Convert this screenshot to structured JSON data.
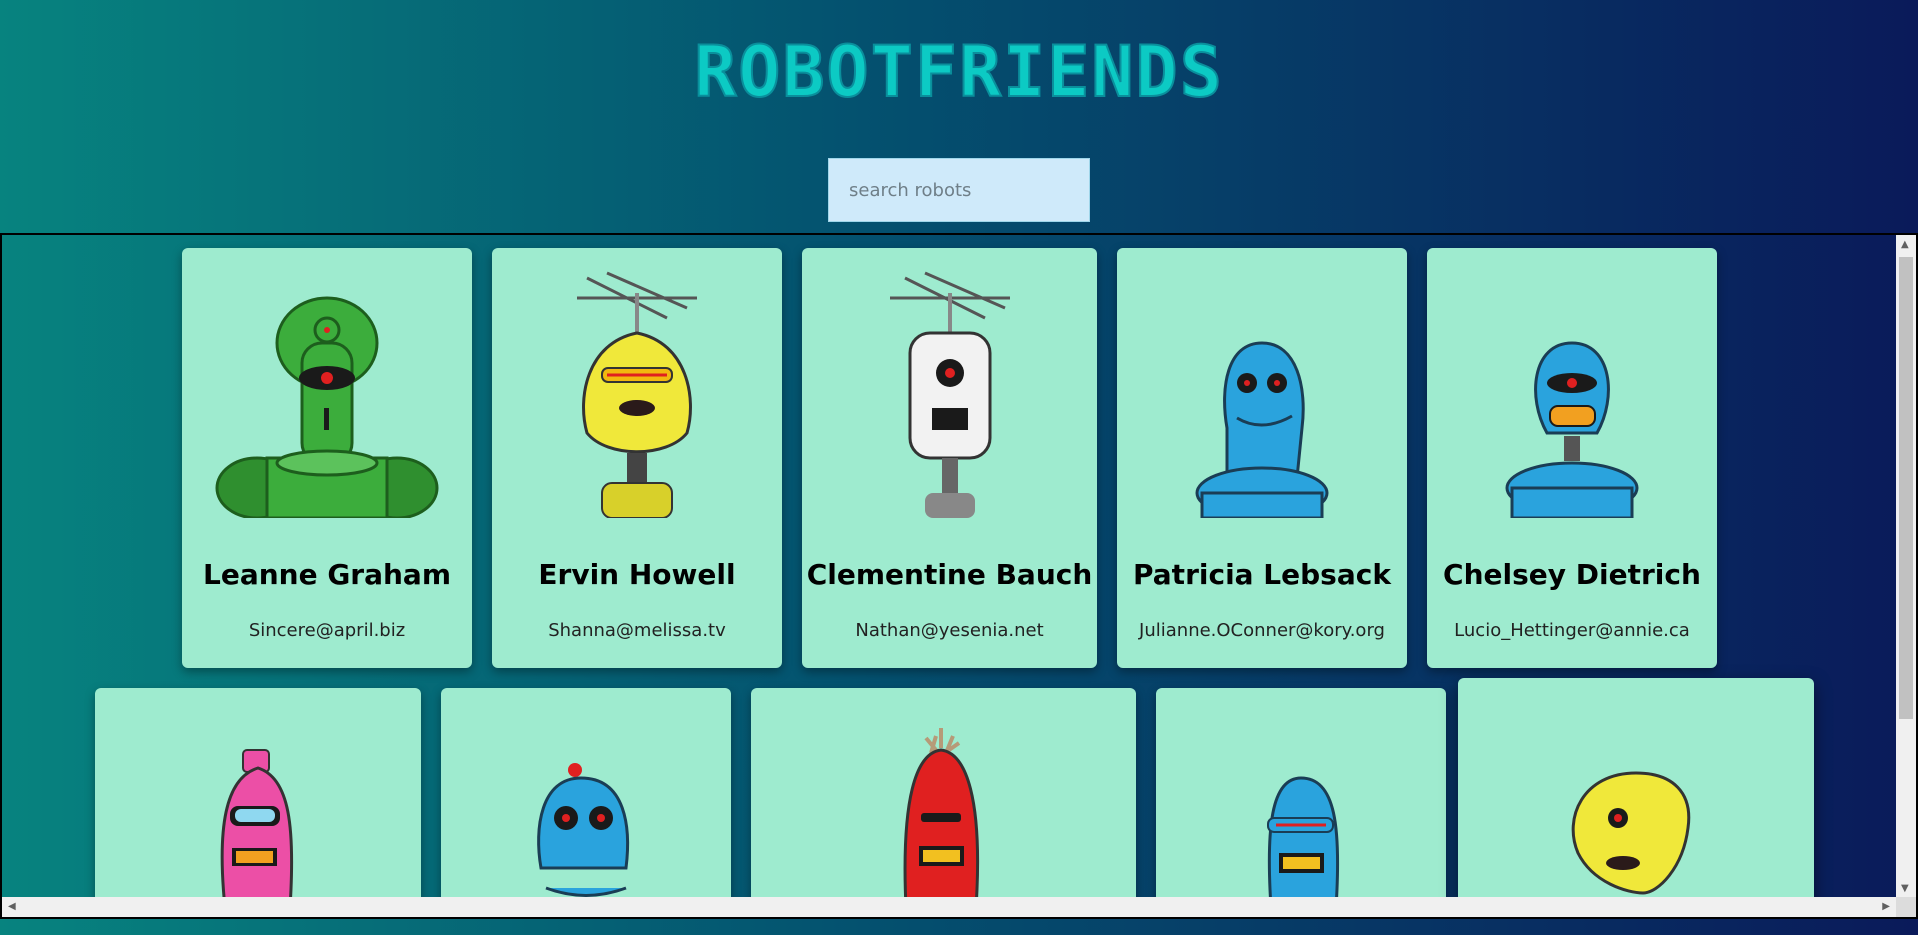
{
  "app": {
    "title": "RobotFriends"
  },
  "search": {
    "placeholder": "search robots",
    "value": ""
  },
  "robots": [
    {
      "name": "Leanne Graham",
      "email": "Sincere@april.biz"
    },
    {
      "name": "Ervin Howell",
      "email": "Shanna@melissa.tv"
    },
    {
      "name": "Clementine Bauch",
      "email": "Nathan@yesenia.net"
    },
    {
      "name": "Patricia Lebsack",
      "email": "Julianne.OConner@kory.org"
    },
    {
      "name": "Chelsey Dietrich",
      "email": "Lucio_Hettinger@annie.ca"
    },
    {
      "name": "",
      "email": ""
    },
    {
      "name": "",
      "email": ""
    },
    {
      "name": "",
      "email": ""
    },
    {
      "name": "",
      "email": ""
    },
    {
      "name": "",
      "email": ""
    }
  ],
  "colors": {
    "card": "#9eebcf",
    "title": "#0ccac4",
    "search_bg": "#cfeafa"
  }
}
